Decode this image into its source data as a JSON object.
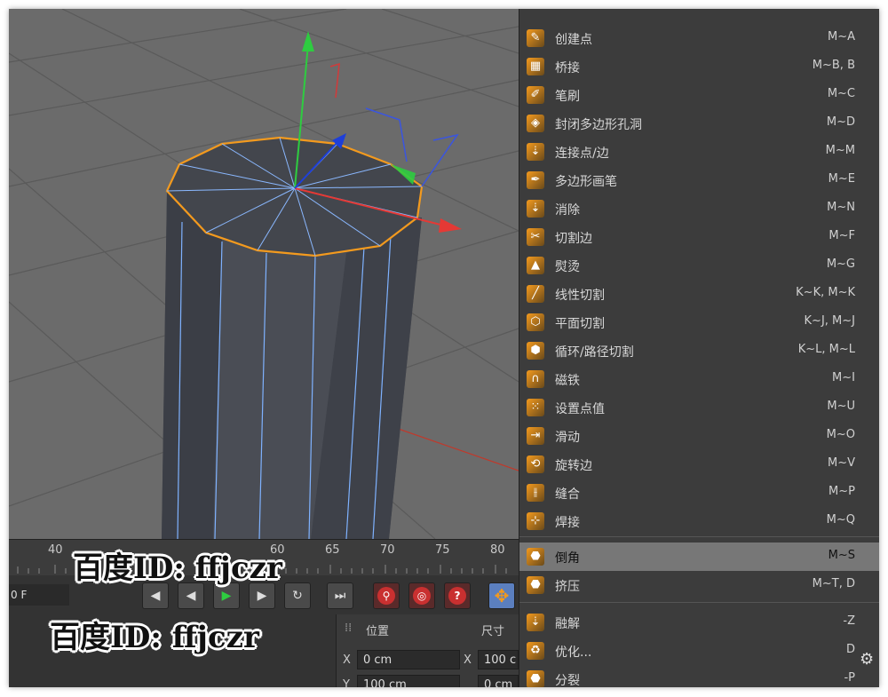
{
  "timeline": {
    "ticks": [
      "40",
      "60",
      "65",
      "70",
      "75",
      "80"
    ]
  },
  "transport": {
    "frame_value": "0 F",
    "question_label": "?"
  },
  "attributes": {
    "position_label": "位置",
    "size_label": "尺寸",
    "x_label": "X",
    "x_position_value": "0 cm",
    "x_size_label": "X",
    "x_size_value": "100 c",
    "y_label": "Y",
    "y_position_value": "100 cm",
    "y_size_value": "0 cm"
  },
  "menu": {
    "items": [
      {
        "label": "创建点",
        "shortcut": "M~A",
        "icon": "create-point-icon"
      },
      {
        "label": "桥接",
        "shortcut": "M~B, B",
        "icon": "bridge-icon"
      },
      {
        "label": "笔刷",
        "shortcut": "M~C",
        "icon": "brush-icon"
      },
      {
        "label": "封闭多边形孔洞",
        "shortcut": "M~D",
        "icon": "close-polygon-hole-icon"
      },
      {
        "label": "连接点/边",
        "shortcut": "M~M",
        "icon": "connect-points-edges-icon"
      },
      {
        "label": "多边形画笔",
        "shortcut": "M~E",
        "icon": "polygon-pen-icon"
      },
      {
        "label": "消除",
        "shortcut": "M~N",
        "icon": "dissolve-icon"
      },
      {
        "label": "切割边",
        "shortcut": "M~F",
        "icon": "edge-cut-icon"
      },
      {
        "label": "熨烫",
        "shortcut": "M~G",
        "icon": "iron-icon"
      },
      {
        "label": "线性切割",
        "shortcut": "K~K, M~K",
        "icon": "line-cut-icon"
      },
      {
        "label": "平面切割",
        "shortcut": "K~J, M~J",
        "icon": "plane-cut-icon"
      },
      {
        "label": "循环/路径切割",
        "shortcut": "K~L, M~L",
        "icon": "loop-path-cut-icon"
      },
      {
        "label": "磁铁",
        "shortcut": "M~I",
        "icon": "magnet-icon"
      },
      {
        "label": "设置点值",
        "shortcut": "M~U",
        "icon": "set-point-value-icon"
      },
      {
        "label": "滑动",
        "shortcut": "M~O",
        "icon": "slide-icon"
      },
      {
        "label": "旋转边",
        "shortcut": "M~V",
        "icon": "spin-edge-icon"
      },
      {
        "label": "缝合",
        "shortcut": "M~P",
        "icon": "stitch-icon"
      },
      {
        "label": "焊接",
        "shortcut": "M~Q",
        "icon": "weld-icon"
      }
    ],
    "items2": [
      {
        "label": "倒角",
        "shortcut": "M~S",
        "icon": "bevel-icon",
        "selected": true
      },
      {
        "label": "挤压",
        "shortcut": "M~T, D",
        "icon": "extrude-icon"
      }
    ],
    "items3": [
      {
        "label": "融解",
        "shortcut": "-Z",
        "icon": "melt-icon"
      },
      {
        "label": "优化...",
        "shortcut": "D",
        "icon": "optimize-icon"
      },
      {
        "label": "分裂",
        "shortcut": "-P",
        "icon": "split-icon"
      }
    ]
  },
  "watermark": {
    "text1": "百度ID: ffjczr",
    "text2": "百度ID: ffjczr"
  },
  "colors": {
    "accent_orange": "#f39a1e",
    "selected_bg": "#777777",
    "menu_bg": "#3c3c3c",
    "viewport_bg": "#6b6b6b"
  }
}
